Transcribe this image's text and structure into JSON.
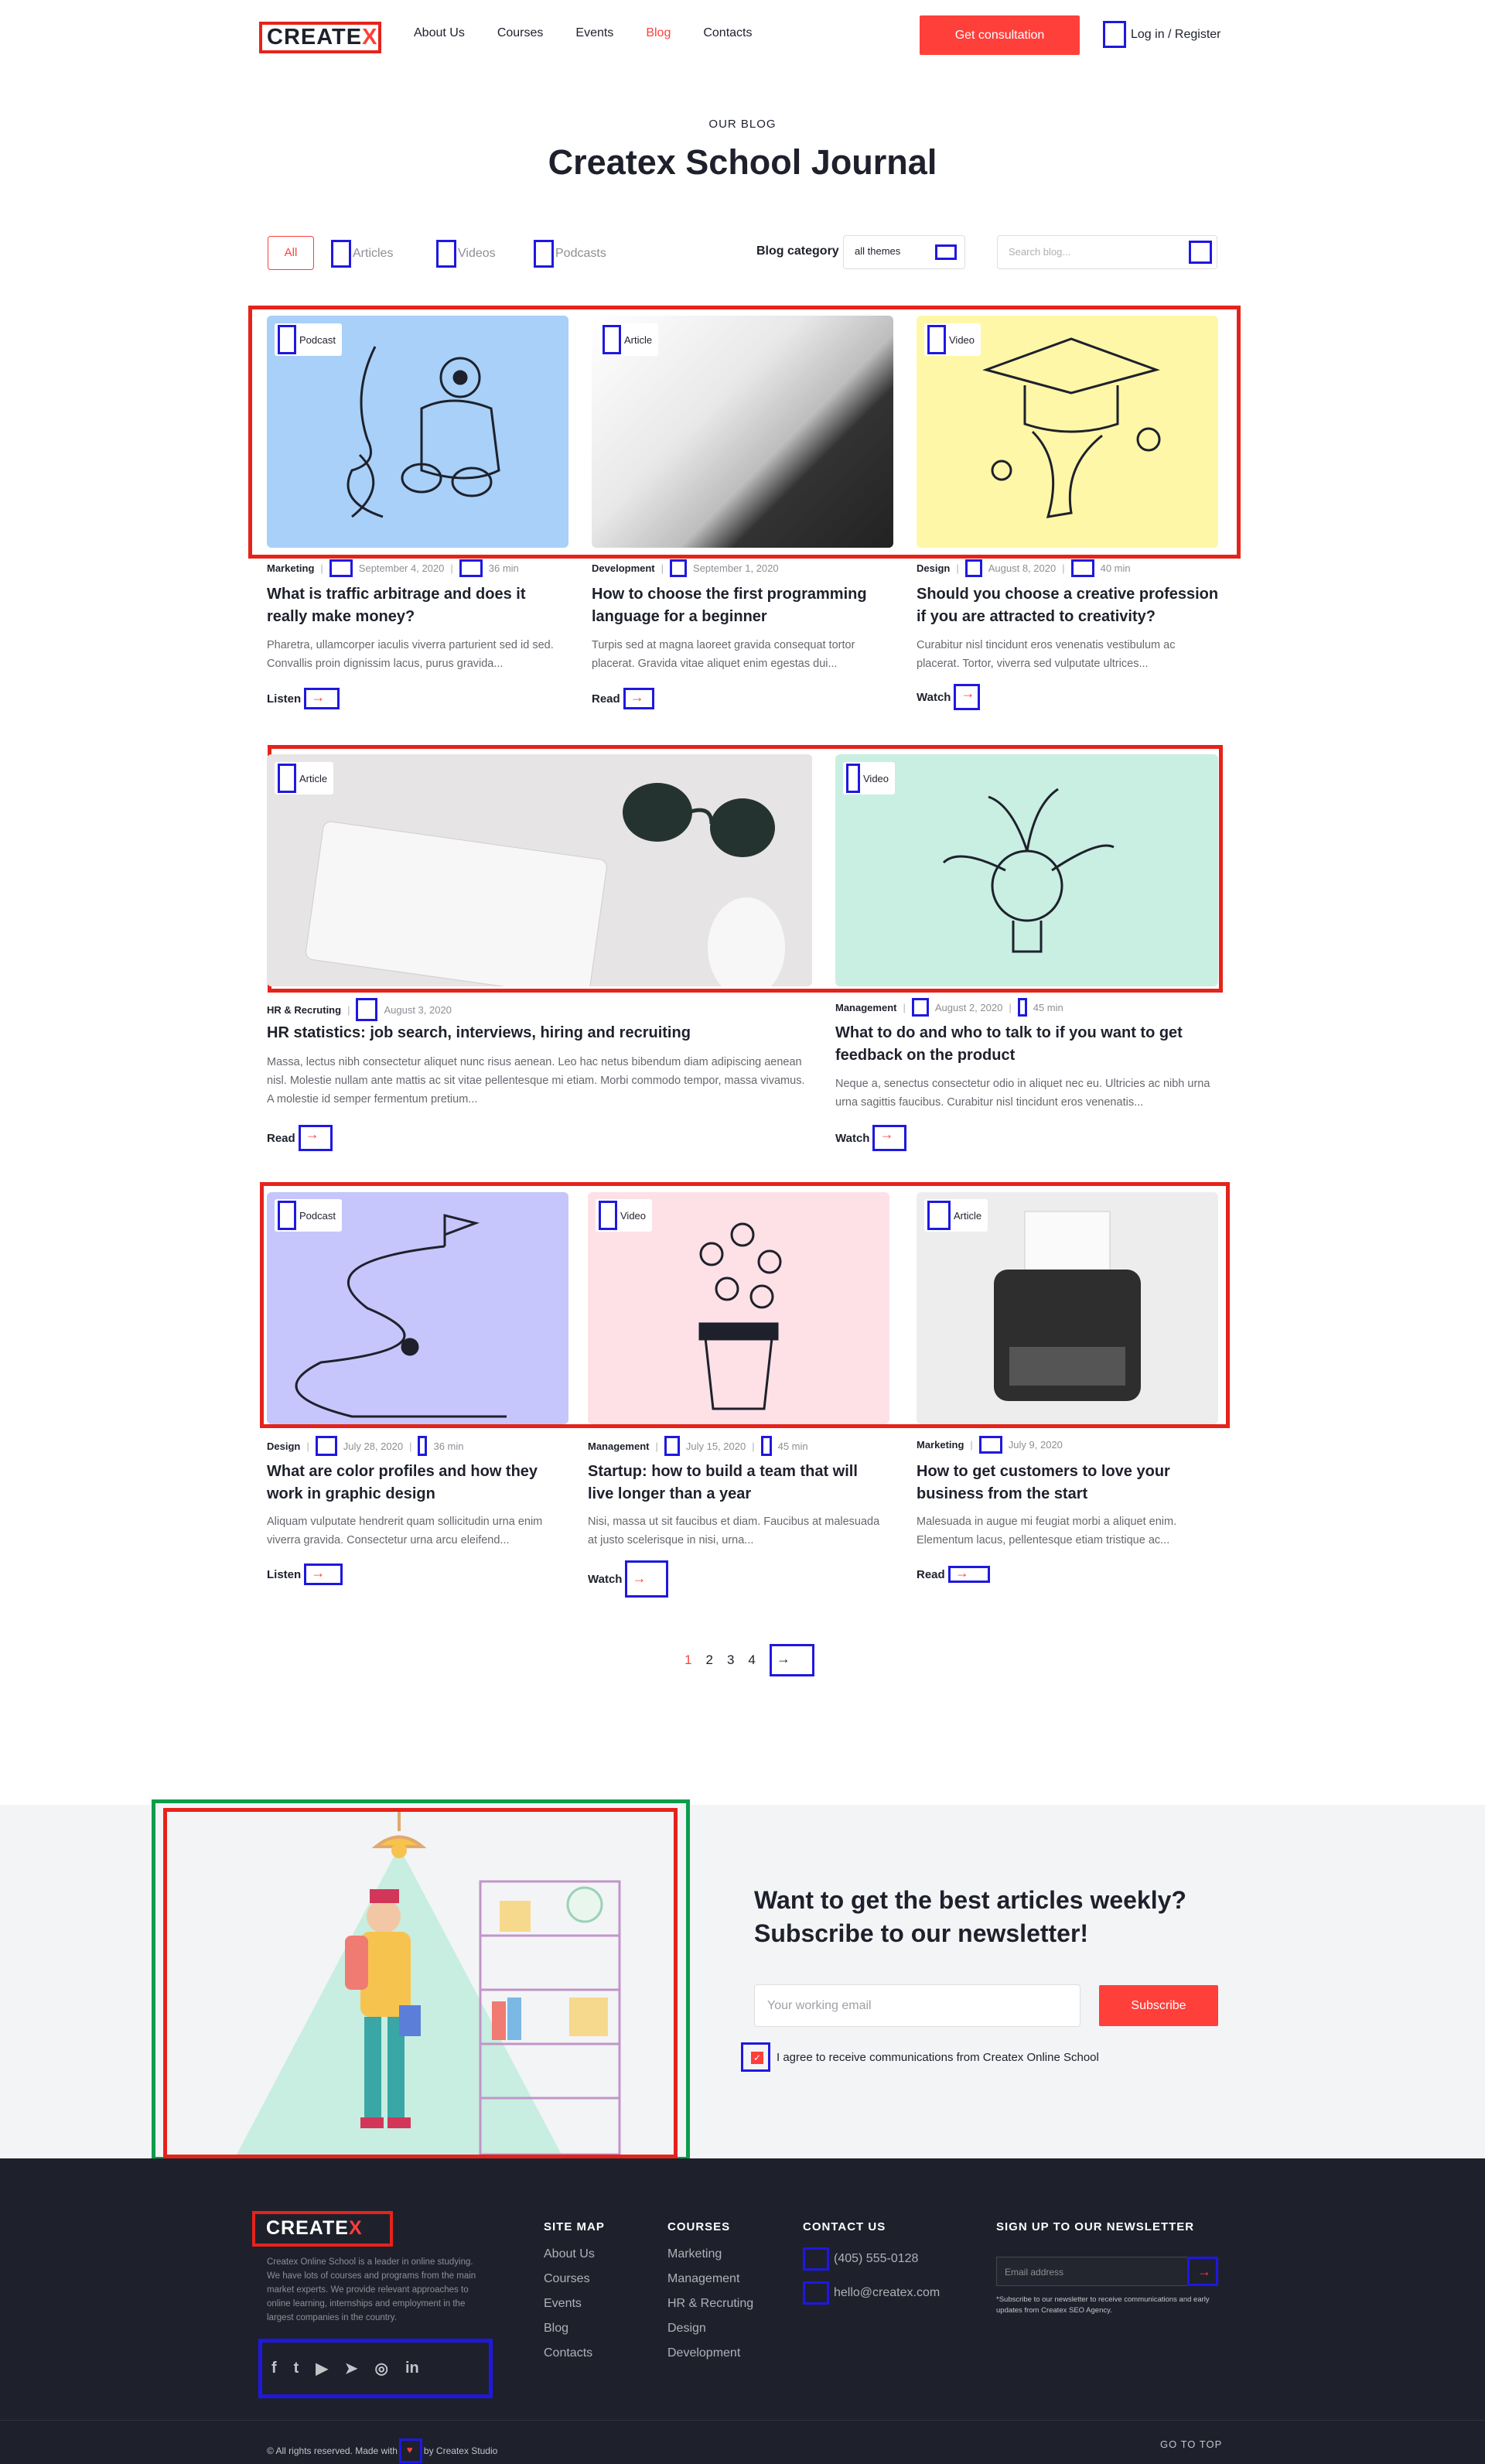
{
  "header": {
    "logo": {
      "main": "CREATE",
      "x": "X"
    },
    "nav": [
      "About Us",
      "Courses",
      "Events",
      "Blog",
      "Contacts"
    ],
    "active_nav": "Blog",
    "cta": "Get consultation",
    "login": "Log in / Register"
  },
  "blog": {
    "eyebrow": "OUR BLOG",
    "title": "Createx School Journal",
    "filters": [
      "All",
      "Articles",
      "Videos",
      "Podcasts"
    ],
    "category_label": "Blog category",
    "category_value": "all themes",
    "search_placeholder": "Search blog..."
  },
  "cards": [
    {
      "tag": "Podcast",
      "category": "Marketing",
      "date": "September 4, 2020",
      "duration": "36 min",
      "title": "What is traffic arbitrage and does it really make money?",
      "text": "Pharetra, ullamcorper iaculis viverra parturient sed id sed. Convallis proin dignissim lacus, purus gravida...",
      "link": "Listen"
    },
    {
      "tag": "Article",
      "category": "Development",
      "date": "September 1, 2020",
      "title": "How to choose the first programming language for a beginner",
      "text": "Turpis sed at magna laoreet gravida consequat tortor placerat. Gravida vitae aliquet enim egestas dui...",
      "link": "Read"
    },
    {
      "tag": "Video",
      "category": "Design",
      "date": "August 8, 2020",
      "duration": "40 min",
      "title": "Should you choose a creative profession if you are attracted to creativity?",
      "text": "Curabitur nisl tincidunt eros venenatis vestibulum ac placerat. Tortor, viverra sed vulputate ultrices...",
      "link": "Watch"
    },
    {
      "tag": "Article",
      "category": "HR & Recruting",
      "date": "August 3, 2020",
      "title": "HR statistics: job search,  interviews, hiring and recruiting",
      "text": "Massa, lectus nibh consectetur aliquet nunc risus aenean. Leo hac netus bibendum diam adipiscing aenean nisl. Molestie nullam ante mattis ac sit vitae pellentesque mi etiam. Morbi commodo tempor, massa vivamus. A molestie id semper fermentum pretium...",
      "link": "Read"
    },
    {
      "tag": "Video",
      "category": "Management",
      "date": "August 2, 2020",
      "duration": "45 min",
      "title": "What to do and who to talk to if you want to get feedback on the product",
      "text": "Neque a, senectus consectetur odio in aliquet nec eu. Ultricies ac nibh urna urna sagittis faucibus. Curabitur nisl tincidunt eros venenatis...",
      "link": "Watch"
    },
    {
      "tag": "Podcast",
      "category": "Design",
      "date": "July 28, 2020",
      "duration": "36 min",
      "title": "What are color profiles and how they work in graphic design",
      "text": "Aliquam vulputate hendrerit quam sollicitudin urna enim viverra gravida. Consectetur urna arcu eleifend...",
      "link": "Listen"
    },
    {
      "tag": "Video",
      "category": "Management",
      "date": "July 15, 2020",
      "duration": "45 min",
      "title": "Startup: how to build a team that will live longer than a year",
      "text": "Nisi, massa ut sit faucibus et diam. Faucibus at malesuada at justo scelerisque in nisi, urna...",
      "link": "Watch"
    },
    {
      "tag": "Article",
      "category": "Marketing",
      "date": "July 9, 2020",
      "title": "How to get customers to love your business from the start",
      "text": "Malesuada in augue mi feugiat morbi a aliquet enim. Elementum lacus, pellentesque etiam tristique ac...",
      "link": "Read"
    }
  ],
  "pagination": [
    "1",
    "2",
    "3",
    "4"
  ],
  "newsletter": {
    "title": "Want to get the best articles weekly? Subscribe to our newsletter!",
    "placeholder": "Your working email",
    "button": "Subscribe",
    "agree": "I agree to receive communications from Createx Online School"
  },
  "footer": {
    "logo": {
      "main": "CREATE",
      "x": "X"
    },
    "about": "Createx Online School is a leader in online studying. We have lots of courses and programs from the main market experts. We provide relevant approaches to online learning, internships and employment in the largest companies in the country.",
    "sitemap_title": "SITE MAP",
    "sitemap": [
      "About Us",
      "Courses",
      "Events",
      "Blog",
      "Contacts"
    ],
    "courses_title": "COURSES",
    "courses": [
      "Marketing",
      "Management",
      "HR & Recruting",
      "Design",
      "Development"
    ],
    "contact_title": "CONTACT US",
    "phone": "(405) 555-0128",
    "email": "hello@createx.com",
    "newsletter_title": "SIGN UP TO OUR NEWSLETTER",
    "newsletter_placeholder": "Email address",
    "newsletter_note": "*Subscribe to our newsletter to receive communications and early updates from Createx SEO Agency.",
    "copyright_pre": "© All rights reserved. Made with",
    "copyright_post": "by Createx Studio",
    "to_top": "GO TO TOP"
  },
  "colors": {
    "accent": "#ff3f3a",
    "dark": "#1e212c",
    "annotation_blue": "#1f18e0",
    "annotation_red": "#e5231b",
    "annotation_green": "#0b9e4c"
  },
  "icons": [
    "article-icon",
    "video-icon",
    "podcast-icon",
    "calendar-icon",
    "clock-icon",
    "arrow-right-icon",
    "chevron-down-icon",
    "search-icon",
    "user-icon",
    "phone-icon",
    "mail-icon",
    "facebook-icon",
    "twitter-icon",
    "youtube-icon",
    "telegram-icon",
    "instagram-icon",
    "linkedin-icon",
    "heart-icon"
  ]
}
